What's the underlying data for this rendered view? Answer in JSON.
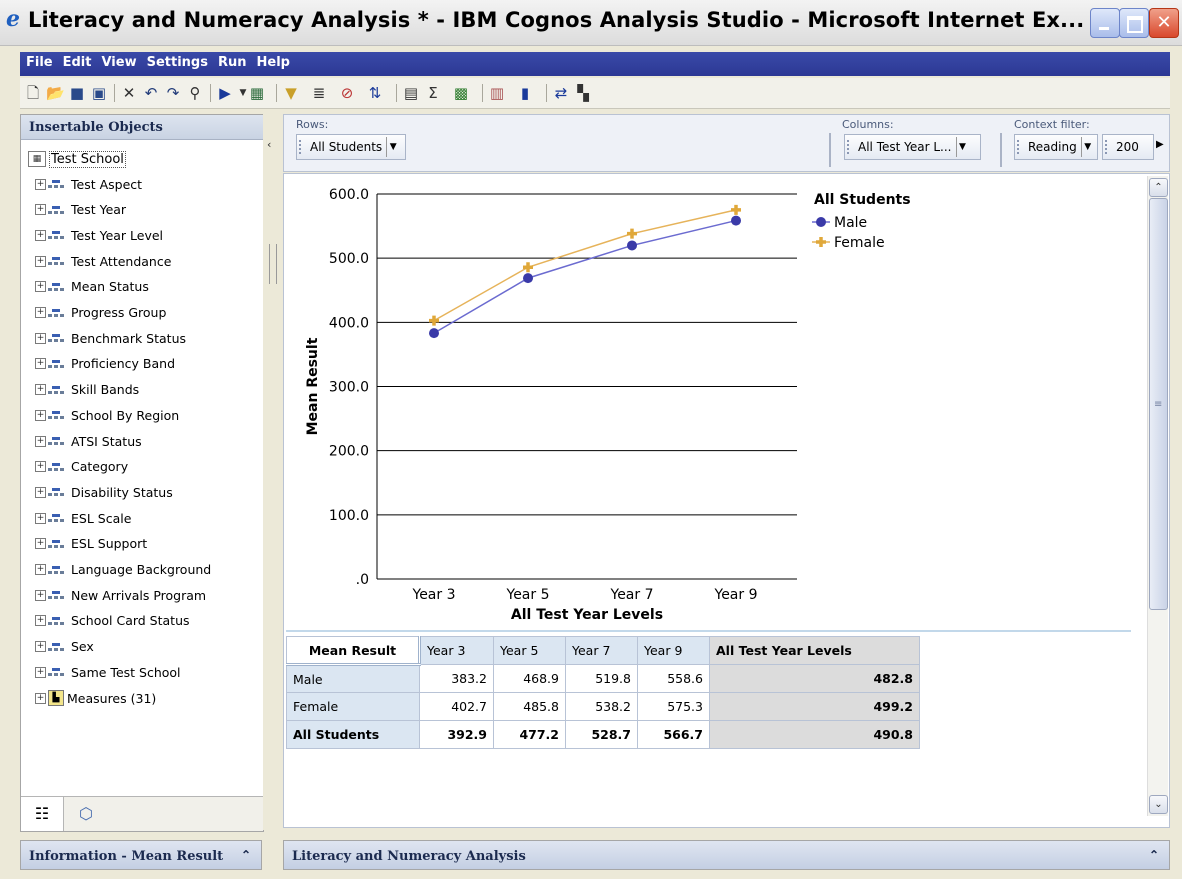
{
  "window": {
    "title": "Literacy and Numeracy Analysis * - IBM Cognos Analysis Studio - Microsoft Internet Ex...",
    "min_label": "_",
    "max_label": "",
    "close_label": "✕"
  },
  "menu": [
    "File",
    "Edit",
    "View",
    "Settings",
    "Run",
    "Help"
  ],
  "toolbar_icons": [
    "new-icon",
    "open-icon",
    "save-icon",
    "save-as-icon",
    "delete-icon",
    "undo-icon",
    "redo-icon",
    "find-icon",
    "run-icon",
    "run-dropdown",
    "layout-icon",
    "filter-icon",
    "suppress-icon",
    "exclude-icon",
    "sort-icon",
    "explain-icon",
    "calculate-icon",
    "totals-icon",
    "chart-type-icon",
    "chart-icon",
    "swap-icon",
    "nest-icon"
  ],
  "left_pane": {
    "header": "Insertable Objects",
    "root": "Test School",
    "items": [
      "Test Aspect",
      "Test Year",
      "Test Year Level",
      "Test Attendance",
      "Mean Status",
      "Progress Group",
      "Benchmark Status",
      "Proficiency Band",
      "Skill Bands",
      "School By Region",
      "ATSI Status",
      "Category",
      "Disability Status",
      "ESL Scale",
      "ESL Support",
      "Language Background",
      "New Arrivals Program",
      "School Card Status",
      "Sex",
      "Same Test School"
    ],
    "measures": "Measures (31)"
  },
  "info_header": "Information - Mean Result",
  "overview": {
    "rows_label": "Rows:",
    "rows_value": "All Students",
    "columns_label": "Columns:",
    "columns_value": "All Test Year L...",
    "context_label": "Context filter:",
    "context_value": "Reading",
    "context_value2": "200"
  },
  "chart_data": {
    "type": "line",
    "categories": [
      "Year 3",
      "Year 5",
      "Year 7",
      "Year 9"
    ],
    "series": [
      {
        "name": "Male",
        "values": [
          383.2,
          468.9,
          519.8,
          558.6
        ],
        "color": "#3a3aa8",
        "marker": "circle"
      },
      {
        "name": "Female",
        "values": [
          402.7,
          485.8,
          538.2,
          575.3
        ],
        "color": "#e0a83a",
        "marker": "plus"
      }
    ],
    "title": "",
    "legend_title": "All Students",
    "xlabel": "All Test Year Levels",
    "ylabel": "Mean Result",
    "yticks": [
      "600.0",
      "500.0",
      "400.0",
      "300.0",
      "200.0",
      "100.0",
      ".0"
    ],
    "ylim": [
      0,
      600
    ],
    "grid": true,
    "legend_position": "top-right"
  },
  "crosstab": {
    "corner": "Mean Result",
    "columns": [
      "Year 3",
      "Year 5",
      "Year 7",
      "Year 9"
    ],
    "total_column": "All Test Year Levels",
    "rows": [
      {
        "label": "Male",
        "values": [
          "383.2",
          "468.9",
          "519.8",
          "558.6"
        ],
        "total": "482.8"
      },
      {
        "label": "Female",
        "values": [
          "402.7",
          "485.8",
          "538.2",
          "575.3"
        ],
        "total": "499.2"
      },
      {
        "label": "All Students",
        "values": [
          "392.9",
          "477.2",
          "528.7",
          "566.7"
        ],
        "total": "490.8"
      }
    ]
  },
  "bottom_header": "Literacy and Numeracy Analysis",
  "colors": {
    "menubar": "#2c3894",
    "male": "#3a3aa8",
    "female": "#e0a83a",
    "header_fill": "#dbe6f2",
    "total_fill": "#dcdcdc"
  }
}
